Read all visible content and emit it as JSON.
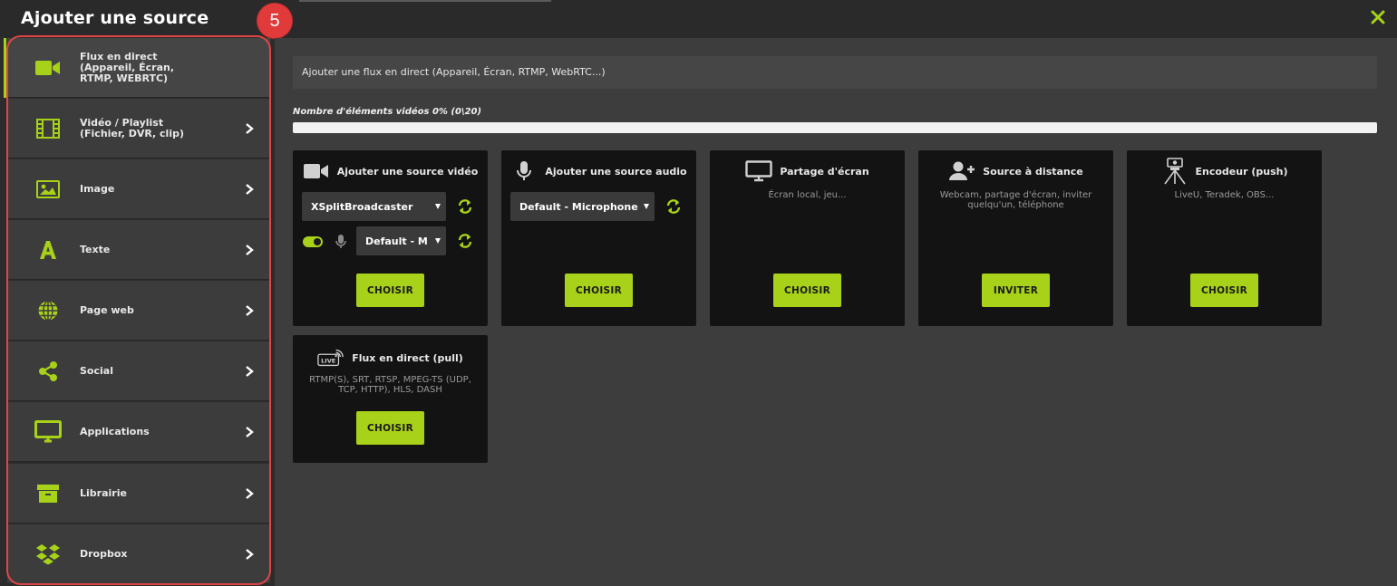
{
  "header": {
    "title": "Ajouter une source",
    "badge": "5"
  },
  "colors": {
    "accent": "#a8d119",
    "badge": "#e03a3a",
    "outline": "#e04545"
  },
  "sidebar": {
    "items": [
      {
        "label": "Flux en direct\n(Appareil, Écran,\nRTMP, WEBRTC)",
        "icon": "video-camera-icon"
      },
      {
        "label": "Vidéo / Playlist\n(Fichier, DVR, clip)",
        "icon": "film-icon"
      },
      {
        "label": "Image",
        "icon": "image-icon"
      },
      {
        "label": "Texte",
        "icon": "text-icon"
      },
      {
        "label": "Page web",
        "icon": "globe-icon"
      },
      {
        "label": "Social",
        "icon": "share-icon"
      },
      {
        "label": "Applications",
        "icon": "monitor-icon"
      },
      {
        "label": "Librairie",
        "icon": "archive-icon"
      },
      {
        "label": "Dropbox",
        "icon": "dropbox-icon"
      }
    ]
  },
  "main": {
    "banner": "Ajouter une flux en direct (Appareil, Écran, RTMP, WebRTC...)",
    "count_label": "Nombre d'éléments vidéos 0% (0\\20)",
    "progress_fraction": 0,
    "cards": {
      "video": {
        "title": "Ajouter une source vidéo",
        "select": "XSplitBroadcaster",
        "audio_select": "Default - M",
        "button": "CHOISIR"
      },
      "audio": {
        "title": "Ajouter une source audio",
        "select": "Default - Microphone"
      },
      "screen": {
        "title": "Partage d'écran",
        "desc": "Écran local, jeu...",
        "button": "CHOISIR"
      },
      "remote": {
        "title": "Source à distance",
        "desc": "Webcam, partage d'écran, inviter quelqu'un, téléphone",
        "button": "INVITER"
      },
      "encoder": {
        "title": "Encodeur (push)",
        "desc": "LiveU, Teradek, OBS...",
        "button": "CHOISIR"
      },
      "pull": {
        "title": "Flux en direct (pull)",
        "icon_text": "LIVE",
        "desc": "RTMP(S), SRT, RTSP, MPEG-TS (UDP, TCP, HTTP), HLS, DASH",
        "button": "CHOISIR"
      }
    },
    "audio_button": "CHOISIR"
  }
}
